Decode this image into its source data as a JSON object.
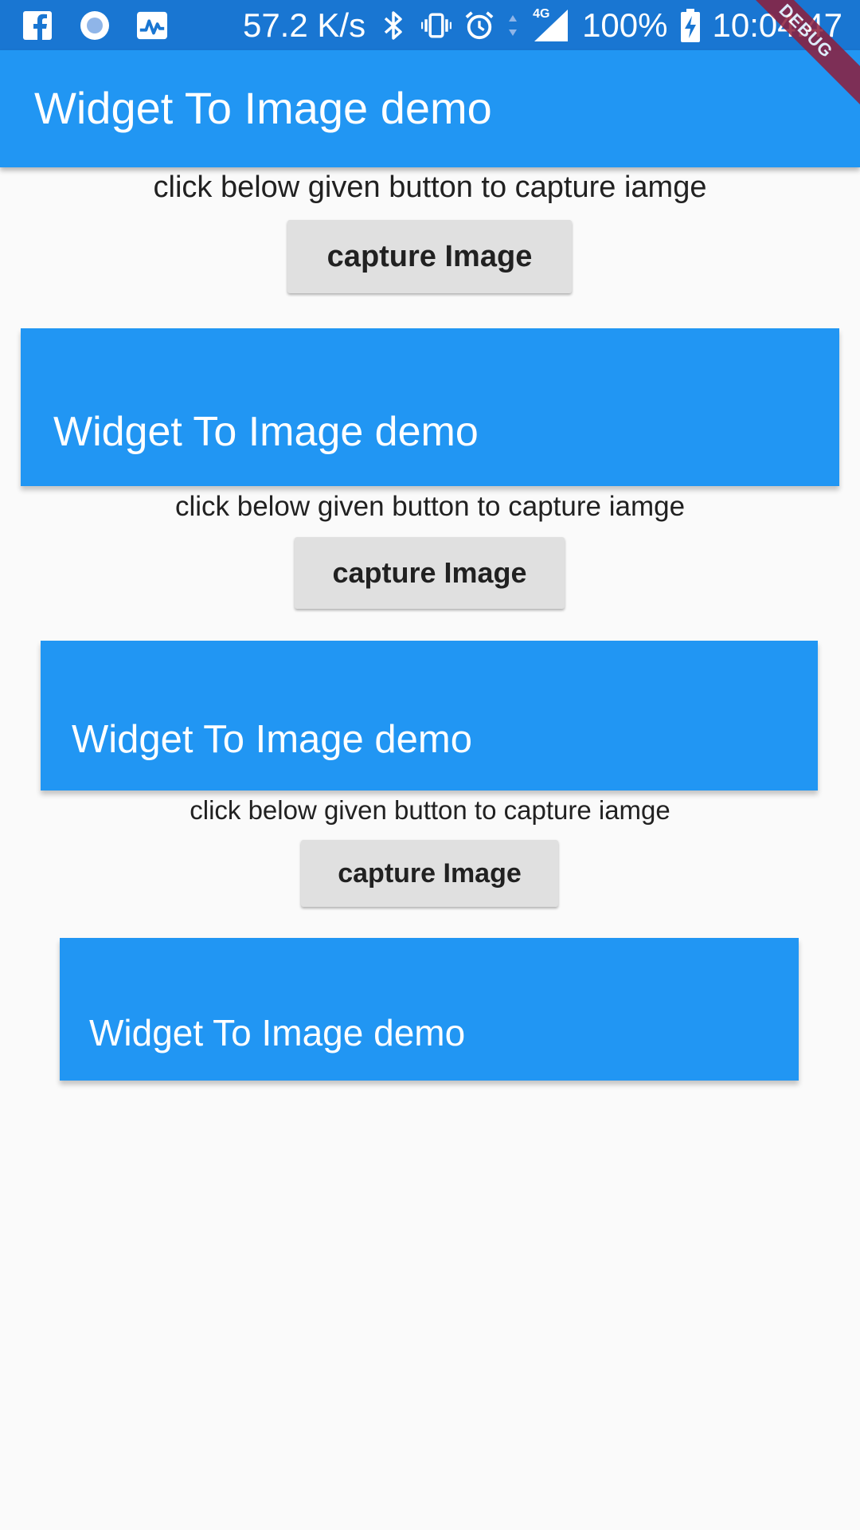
{
  "status_bar": {
    "net_speed": "57.2 K/s",
    "network_type": "4G",
    "battery": "100%",
    "time": "10:04:47",
    "icons": [
      "facebook-icon",
      "circle-app-icon",
      "activity-monitor-icon",
      "bluetooth-icon",
      "vibrate-icon",
      "alarm-icon",
      "data-arrows-icon",
      "signal-icon",
      "battery-charging-icon"
    ]
  },
  "debug_banner": "DEBUG",
  "app_bar": {
    "title": "Widget To Image demo"
  },
  "main": {
    "hint": "click below given button to capture iamge",
    "button_label": "capture Image"
  },
  "captures": [
    {
      "title": "Widget To Image demo",
      "hint": "click below given button to capture iamge",
      "button_label": "capture Image"
    },
    {
      "title": "Widget To Image demo",
      "hint": "click below given button to capture iamge",
      "button_label": "capture Image"
    },
    {
      "title": "Widget To Image demo"
    }
  ],
  "colors": {
    "status_bar": "#1976d2",
    "app_bar": "#2196f3",
    "background": "#fafafa",
    "button": "#e0e0e0",
    "text": "#212121",
    "debug_banner": "#8e1e3b"
  }
}
